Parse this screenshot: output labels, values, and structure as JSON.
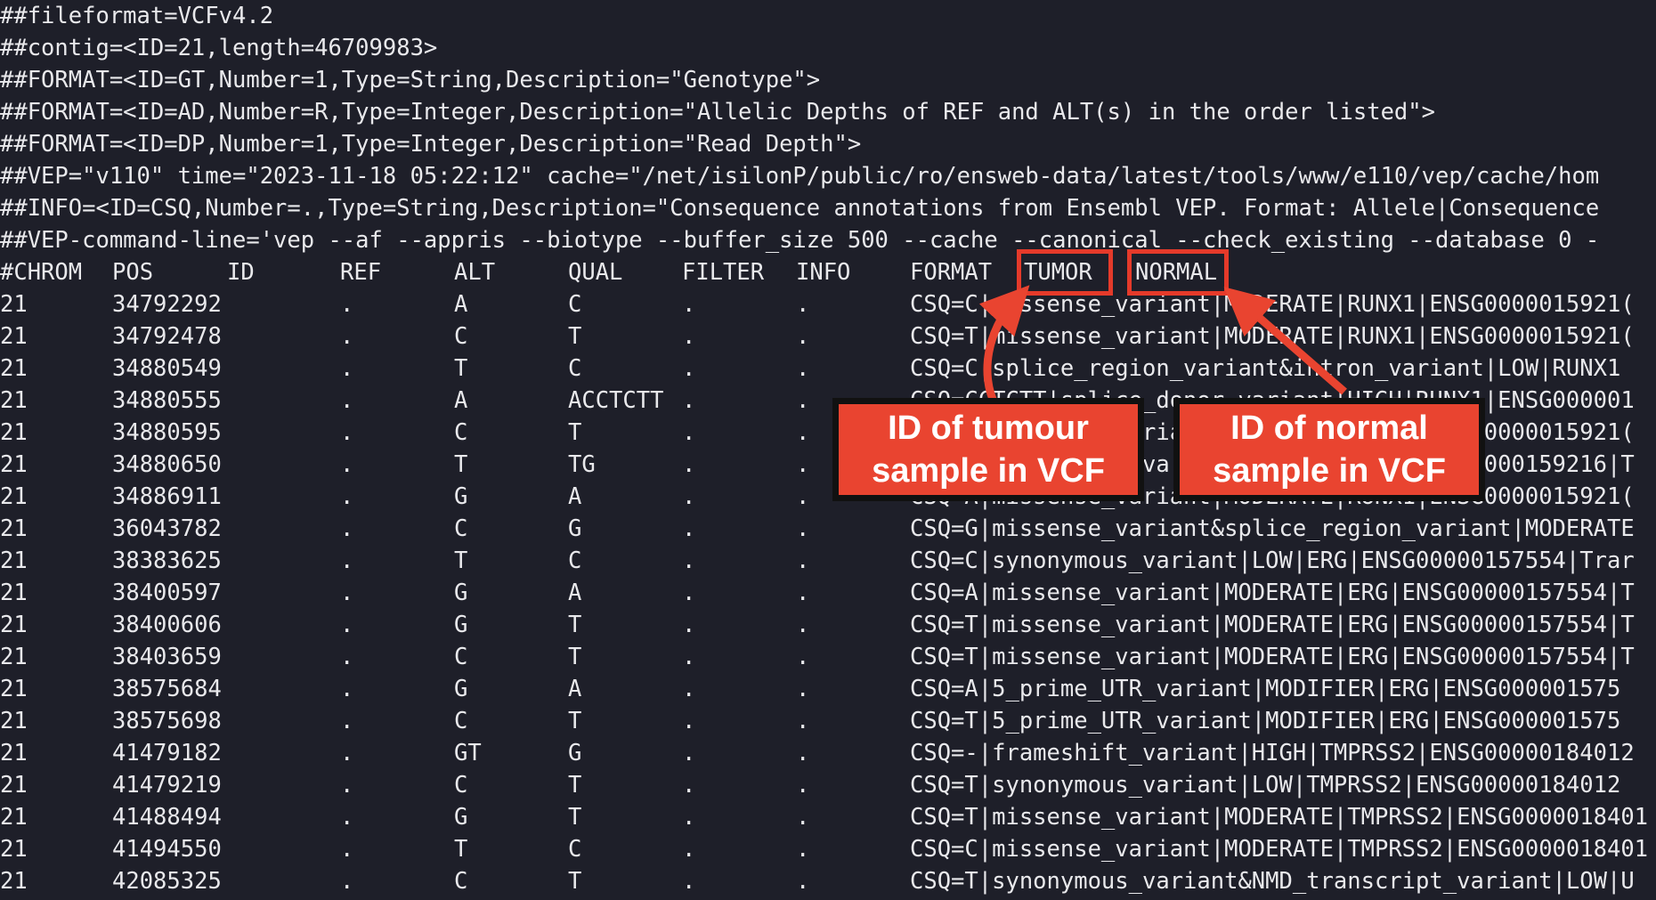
{
  "terminal": {
    "meta_lines": [
      "##fileformat=VCFv4.2",
      "##contig=<ID=21,length=46709983>",
      "##FORMAT=<ID=GT,Number=1,Type=String,Description=\"Genotype\">",
      "##FORMAT=<ID=AD,Number=R,Type=Integer,Description=\"Allelic Depths of REF and ALT(s) in the order listed\">",
      "##FORMAT=<ID=DP,Number=1,Type=Integer,Description=\"Read Depth\">",
      "##VEP=\"v110\" time=\"2023-11-18 05:22:12\" cache=\"/net/isilonP/public/ro/ensweb-data/latest/tools/www/e110/vep/cache/hom",
      "##INFO=<ID=CSQ,Number=.,Type=String,Description=\"Consequence annotations from Ensembl VEP. Format: Allele|Consequence",
      "##VEP-command-line='vep --af --appris --biotype --buffer_size 500 --cache --canonical --check_existing --database 0 -"
    ],
    "header": {
      "chrom": "#CHROM",
      "pos": "POS",
      "id": "ID",
      "ref": "REF",
      "alt": "ALT",
      "qual": "QUAL",
      "filter": "FILTER",
      "info": "INFO",
      "format": "FORMAT",
      "tumor": "TUMOR",
      "normal": "NORMAL"
    },
    "rows": [
      {
        "chrom": "21",
        "pos": "34792292",
        "id": ".",
        "ref": "A",
        "alt": "C",
        "qual": ".",
        "filter": ".",
        "info": "CSQ=C|missense_variant|MODERATE|RUNX1|ENSG0000015921("
      },
      {
        "chrom": "21",
        "pos": "34792478",
        "id": ".",
        "ref": "C",
        "alt": "T",
        "qual": ".",
        "filter": ".",
        "info": "CSQ=T|missense_variant|MODERATE|RUNX1|ENSG0000015921("
      },
      {
        "chrom": "21",
        "pos": "34880549",
        "id": ".",
        "ref": "T",
        "alt": "C",
        "qual": ".",
        "filter": ".",
        "info": "CSQ=C|splice_region_variant&intron_variant|LOW|RUNX1 "
      },
      {
        "chrom": "21",
        "pos": "34880555",
        "id": ".",
        "ref": "A",
        "alt": "ACCTCTT",
        "qual": ".",
        "filter": ".",
        "info": "CSQ=CCTCTT|splice_donor_variant|HIGH|RUNX1|ENSG000001"
      },
      {
        "chrom": "21",
        "pos": "34880595",
        "id": ".",
        "ref": "C",
        "alt": "T",
        "qual": ".",
        "filter": ".",
        "info": "CSQ=T|missense_variant|MODERATE|RUNX1|ENSG0000015921("
      },
      {
        "chrom": "21",
        "pos": "34880650",
        "id": ".",
        "ref": "T",
        "alt": "TG",
        "qual": ".",
        "filter": ".",
        "info": "CSQ=G|frameshift_variant|HIGH|RUNX1|ENSG00000159216|T"
      },
      {
        "chrom": "21",
        "pos": "34886911",
        "id": ".",
        "ref": "G",
        "alt": "A",
        "qual": ".",
        "filter": ".",
        "info": "CSQ=A|missense_variant|MODERATE|RUNX1|ENSG0000015921("
      },
      {
        "chrom": "21",
        "pos": "36043782",
        "id": ".",
        "ref": "C",
        "alt": "G",
        "qual": ".",
        "filter": ".",
        "info": "CSQ=G|missense_variant&splice_region_variant|MODERATE"
      },
      {
        "chrom": "21",
        "pos": "38383625",
        "id": ".",
        "ref": "T",
        "alt": "C",
        "qual": ".",
        "filter": ".",
        "info": "CSQ=C|synonymous_variant|LOW|ERG|ENSG00000157554|Trar"
      },
      {
        "chrom": "21",
        "pos": "38400597",
        "id": ".",
        "ref": "G",
        "alt": "A",
        "qual": ".",
        "filter": ".",
        "info": "CSQ=A|missense_variant|MODERATE|ERG|ENSG00000157554|T"
      },
      {
        "chrom": "21",
        "pos": "38400606",
        "id": ".",
        "ref": "G",
        "alt": "T",
        "qual": ".",
        "filter": ".",
        "info": "CSQ=T|missense_variant|MODERATE|ERG|ENSG00000157554|T"
      },
      {
        "chrom": "21",
        "pos": "38403659",
        "id": ".",
        "ref": "C",
        "alt": "T",
        "qual": ".",
        "filter": ".",
        "info": "CSQ=T|missense_variant|MODERATE|ERG|ENSG00000157554|T"
      },
      {
        "chrom": "21",
        "pos": "38575684",
        "id": ".",
        "ref": "G",
        "alt": "A",
        "qual": ".",
        "filter": ".",
        "info": "CSQ=A|5_prime_UTR_variant|MODIFIER|ERG|ENSG000001575"
      },
      {
        "chrom": "21",
        "pos": "38575698",
        "id": ".",
        "ref": "C",
        "alt": "T",
        "qual": ".",
        "filter": ".",
        "info": "CSQ=T|5_prime_UTR_variant|MODIFIER|ERG|ENSG000001575"
      },
      {
        "chrom": "21",
        "pos": "41479182",
        "id": ".",
        "ref": "GT",
        "alt": "G",
        "qual": ".",
        "filter": ".",
        "info": "CSQ=-|frameshift_variant|HIGH|TMPRSS2|ENSG00000184012"
      },
      {
        "chrom": "21",
        "pos": "41479219",
        "id": ".",
        "ref": "C",
        "alt": "T",
        "qual": ".",
        "filter": ".",
        "info": "CSQ=T|synonymous_variant|LOW|TMPRSS2|ENSG00000184012 "
      },
      {
        "chrom": "21",
        "pos": "41488494",
        "id": ".",
        "ref": "G",
        "alt": "T",
        "qual": ".",
        "filter": ".",
        "info": "CSQ=T|missense_variant|MODERATE|TMPRSS2|ENSG0000018401"
      },
      {
        "chrom": "21",
        "pos": "41494550",
        "id": ".",
        "ref": "T",
        "alt": "C",
        "qual": ".",
        "filter": ".",
        "info": "CSQ=C|missense_variant|MODERATE|TMPRSS2|ENSG0000018401"
      },
      {
        "chrom": "21",
        "pos": "42085325",
        "id": ".",
        "ref": "C",
        "alt": "T",
        "qual": ".",
        "filter": ".",
        "info": "CSQ=T|synonymous_variant&NMD_transcript_variant|LOW|U"
      }
    ]
  },
  "annotations": {
    "tumor_callout": [
      "ID of tumour",
      "sample in VCF"
    ],
    "normal_callout": [
      "ID of normal",
      "sample in VCF"
    ],
    "accent_color": "#e94430"
  }
}
